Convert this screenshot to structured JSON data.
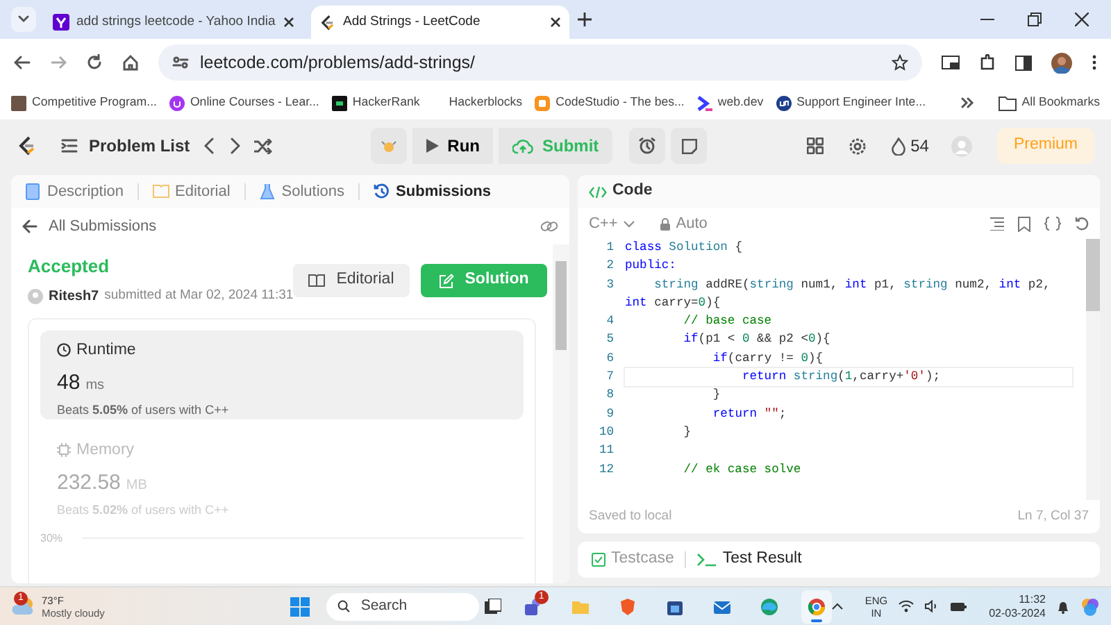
{
  "browser": {
    "tabs": [
      {
        "title": "add strings leetcode - Yahoo India",
        "kind": "yahoo",
        "selected": false
      },
      {
        "title": "Add Strings - LeetCode",
        "kind": "leetcode",
        "selected": true
      }
    ],
    "url": "leetcode.com/problems/add-strings/",
    "bookmarks": [
      {
        "label": "Competitive Program...",
        "kind": "cc"
      },
      {
        "label": "Online Courses - Lear...",
        "kind": "udemy"
      },
      {
        "label": "HackerRank",
        "kind": "hr"
      },
      {
        "label": "Hackerblocks",
        "kind": "none"
      },
      {
        "label": "CodeStudio - The bes...",
        "kind": "cs"
      },
      {
        "label": "web.dev",
        "kind": "webdev"
      },
      {
        "label": "Support Engineer Inte...",
        "kind": "un"
      }
    ],
    "all_bookmarks": "All Bookmarks"
  },
  "toolbar": {
    "problem_list": "Problem List",
    "run": "Run",
    "submit": "Submit",
    "streak": "54",
    "premium": "Premium"
  },
  "left_panel": {
    "tabs": [
      {
        "label": "Description",
        "kind": "doc",
        "selected": false
      },
      {
        "label": "Editorial",
        "kind": "book",
        "selected": false
      },
      {
        "label": "Solutions",
        "kind": "flask",
        "selected": false
      },
      {
        "label": "Submissions",
        "kind": "history",
        "selected": true
      }
    ],
    "back_link": "All Submissions",
    "status": "Accepted",
    "user": "Ritesh7",
    "submitted": "submitted at Mar 02, 2024 11:31",
    "editorial_button": "Editorial",
    "solution_button": "Solution",
    "stats": [
      {
        "title": "Runtime",
        "kind": "clock",
        "value": "48",
        "unit": "ms",
        "beats": "Beats **5.05%** of users with C++",
        "selected": true
      },
      {
        "title": "Memory",
        "kind": "chip",
        "value": "232.58",
        "unit": "MB",
        "beats": "Beats **5.02%** of users with C++",
        "selected": false
      }
    ],
    "chart_tick": "30%"
  },
  "code_panel": {
    "title": "Code",
    "language": "C++",
    "mode": "Auto",
    "lines": [
      {
        "number": "1",
        "active": false,
        "segments": [
          {
            "kind": "kw",
            "text": "class"
          },
          {
            "kind": "type",
            "text": " Solution"
          },
          {
            "kind": "plain",
            "text": " {"
          }
        ]
      },
      {
        "number": "2",
        "active": false,
        "segments": [
          {
            "kind": "kw",
            "text": "public:"
          }
        ]
      },
      {
        "number": "3",
        "active": false,
        "segments": [
          {
            "kind": "type",
            "text": "    string"
          },
          {
            "kind": "plain",
            "text": " addRE("
          },
          {
            "kind": "type",
            "text": "string"
          },
          {
            "kind": "plain",
            "text": " num1, "
          },
          {
            "kind": "kw",
            "text": "int"
          },
          {
            "kind": "plain",
            "text": " p1, "
          },
          {
            "kind": "type",
            "text": "string"
          },
          {
            "kind": "plain",
            "text": " num2, "
          },
          {
            "kind": "kw",
            "text": "int"
          },
          {
            "kind": "plain",
            "text": " p2, "
          },
          {
            "kind": "kw",
            "text": "int"
          },
          {
            "kind": "plain",
            "text": " carry="
          },
          {
            "kind": "num",
            "text": "0"
          },
          {
            "kind": "plain",
            "text": "){"
          }
        ]
      },
      {
        "number": "4",
        "active": false,
        "segments": [
          {
            "kind": "cmt",
            "text": "        // base case"
          }
        ]
      },
      {
        "number": "5",
        "active": false,
        "segments": [
          {
            "kind": "kw",
            "text": "        if"
          },
          {
            "kind": "plain",
            "text": "(p1 < "
          },
          {
            "kind": "num",
            "text": "0"
          },
          {
            "kind": "plain",
            "text": " && p2 <"
          },
          {
            "kind": "num",
            "text": "0"
          },
          {
            "kind": "plain",
            "text": "){"
          }
        ]
      },
      {
        "number": "6",
        "active": false,
        "segments": [
          {
            "kind": "kw",
            "text": "            if"
          },
          {
            "kind": "plain",
            "text": "(carry != "
          },
          {
            "kind": "num",
            "text": "0"
          },
          {
            "kind": "plain",
            "text": "){"
          }
        ]
      },
      {
        "number": "7",
        "active": true,
        "segments": [
          {
            "kind": "kw",
            "text": "                return"
          },
          {
            "kind": "type",
            "text": " string"
          },
          {
            "kind": "plain",
            "text": "("
          },
          {
            "kind": "num",
            "text": "1"
          },
          {
            "kind": "plain",
            "text": ",carry+"
          },
          {
            "kind": "str",
            "text": "'0'"
          },
          {
            "kind": "plain",
            "text": ");"
          }
        ]
      },
      {
        "number": "8",
        "active": false,
        "segments": [
          {
            "kind": "plain",
            "text": "            }"
          }
        ]
      },
      {
        "number": "9",
        "active": false,
        "segments": [
          {
            "kind": "kw",
            "text": "            return"
          },
          {
            "kind": "str",
            "text": " \"\""
          },
          {
            "kind": "plain",
            "text": ";"
          }
        ]
      },
      {
        "number": "10",
        "active": false,
        "segments": [
          {
            "kind": "plain",
            "text": "        }"
          }
        ]
      },
      {
        "number": "11",
        "active": false
      },
      {
        "number": "12",
        "active": false,
        "segments": [
          {
            "kind": "cmt",
            "text": "        // ek case solve"
          }
        ]
      }
    ],
    "saved": "Saved to local",
    "cursor": "Ln 7, Col 37"
  },
  "bottom_tabs": [
    {
      "label": "Testcase",
      "kind": "check",
      "selected": false
    },
    {
      "label": "Test Result",
      "kind": "terminal",
      "selected": true
    }
  ],
  "taskbar": {
    "temperature": "73°F",
    "weather": "Mostly cloudy",
    "weather_badge": "1",
    "search": "Search",
    "apps": [
      {
        "kind": "teams",
        "badge": "1",
        "selected": false
      },
      {
        "kind": "files",
        "selected": false
      },
      {
        "kind": "brave",
        "selected": false
      },
      {
        "kind": "store",
        "selected": false
      },
      {
        "kind": "mail",
        "selected": false
      },
      {
        "kind": "edge",
        "selected": false
      },
      {
        "kind": "chrome",
        "selected": true
      }
    ],
    "language": "ENG",
    "region": "IN",
    "time": "11:32",
    "date": "02-03-2024"
  }
}
